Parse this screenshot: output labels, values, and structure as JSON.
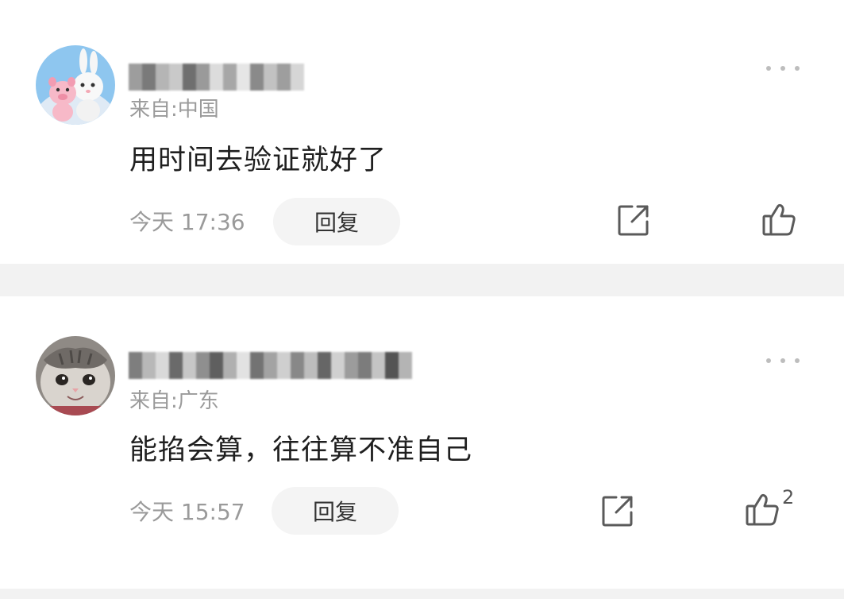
{
  "comments": [
    {
      "origin": "来自:中国",
      "text": "用时间去验证就好了",
      "time": "今天 17:36",
      "reply_label": "回复",
      "like_count": "",
      "avatar_icon": "rabbit-and-pig-plush-avatar"
    },
    {
      "origin": "来自:广东",
      "text": "能掐会算，往往算不准自己",
      "time": "今天 15:57",
      "reply_label": "回复",
      "like_count": "2",
      "avatar_icon": "cat-face-avatar"
    }
  ],
  "icons": {
    "more": "more-options-icon",
    "share": "share-icon",
    "like": "thumbs-up-icon"
  },
  "colors": {
    "background": "#f2f2f2",
    "card": "#ffffff",
    "secondary_text": "#9a9a9a",
    "primary_text": "#1f1f1f",
    "reply_pill": "#f4f4f4"
  }
}
